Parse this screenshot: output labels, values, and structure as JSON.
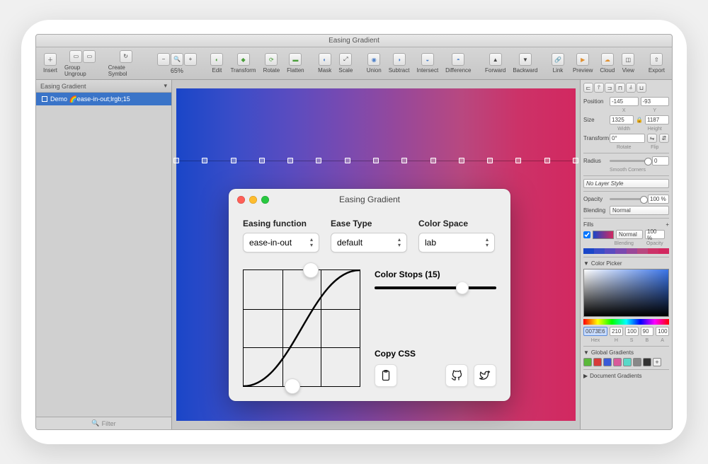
{
  "window": {
    "title": "Easing Gradient"
  },
  "toolbar": {
    "insert": "Insert",
    "group": "Group",
    "ungroup": "Ungroup",
    "create_symbol": "Create Symbol",
    "zoom": "65%",
    "edit": "Edit",
    "transform": "Transform",
    "rotate": "Rotate",
    "flatten": "Flatten",
    "mask": "Mask",
    "scale": "Scale",
    "union": "Union",
    "subtract": "Subtract",
    "intersect": "Intersect",
    "difference": "Difference",
    "forward": "Forward",
    "backward": "Backward",
    "link": "Link",
    "preview": "Preview",
    "cloud": "Cloud",
    "view": "View",
    "export": "Export"
  },
  "left_panel": {
    "header": "Easing Gradient",
    "layer_name": "Demo 🌈ease-in-out;lrgb;15",
    "filter_placeholder": "Filter"
  },
  "inspector": {
    "position": {
      "label": "Position",
      "x": "-145",
      "y": "-93",
      "x_lbl": "X",
      "y_lbl": "Y"
    },
    "size": {
      "label": "Size",
      "w": "1325",
      "h": "1187",
      "w_lbl": "Width",
      "h_lbl": "Height"
    },
    "transform": {
      "label": "Transform",
      "rotate": "0°",
      "rotate_lbl": "Rotate",
      "flip_lbl": "Flip"
    },
    "radius": {
      "label": "Radius",
      "value": "0",
      "smooth": "Smooth Corners"
    },
    "layer_style": "No Layer Style",
    "opacity": {
      "label": "Opacity",
      "value": "100 %"
    },
    "blending": {
      "label": "Blending",
      "value": "Normal"
    },
    "fills": {
      "label": "Fills",
      "blend": "Normal",
      "opacity": "100 %",
      "blend_lbl": "Blending",
      "opacity_lbl": "Opacity"
    },
    "color_picker": {
      "label": "Color Picker",
      "hex": "0073E6",
      "hex_lbl": "Hex",
      "h": "210",
      "h_lbl": "H",
      "s": "100",
      "s_lbl": "S",
      "b": "90",
      "b_lbl": "B",
      "a": "100",
      "a_lbl": "A"
    },
    "global_gradients": "Global Gradients",
    "document_gradients": "Document Gradients"
  },
  "plugin": {
    "title": "Easing Gradient",
    "easing_function": {
      "label": "Easing function",
      "value": "ease-in-out"
    },
    "ease_type": {
      "label": "Ease Type",
      "value": "default"
    },
    "color_space": {
      "label": "Color Space",
      "value": "lab"
    },
    "color_stops": {
      "label": "Color Stops (15)",
      "value": 15,
      "min": 2,
      "max": 20
    },
    "copy_css": "Copy CSS",
    "curve": {
      "p1": [
        0.42,
        0
      ],
      "p2": [
        0.58,
        1
      ]
    }
  },
  "swatches": {
    "global": [
      "#5ab83a",
      "#d83a3a",
      "#3a5ad8",
      "#d85a9a",
      "#5ad8c8",
      "#888888",
      "#333333"
    ]
  }
}
